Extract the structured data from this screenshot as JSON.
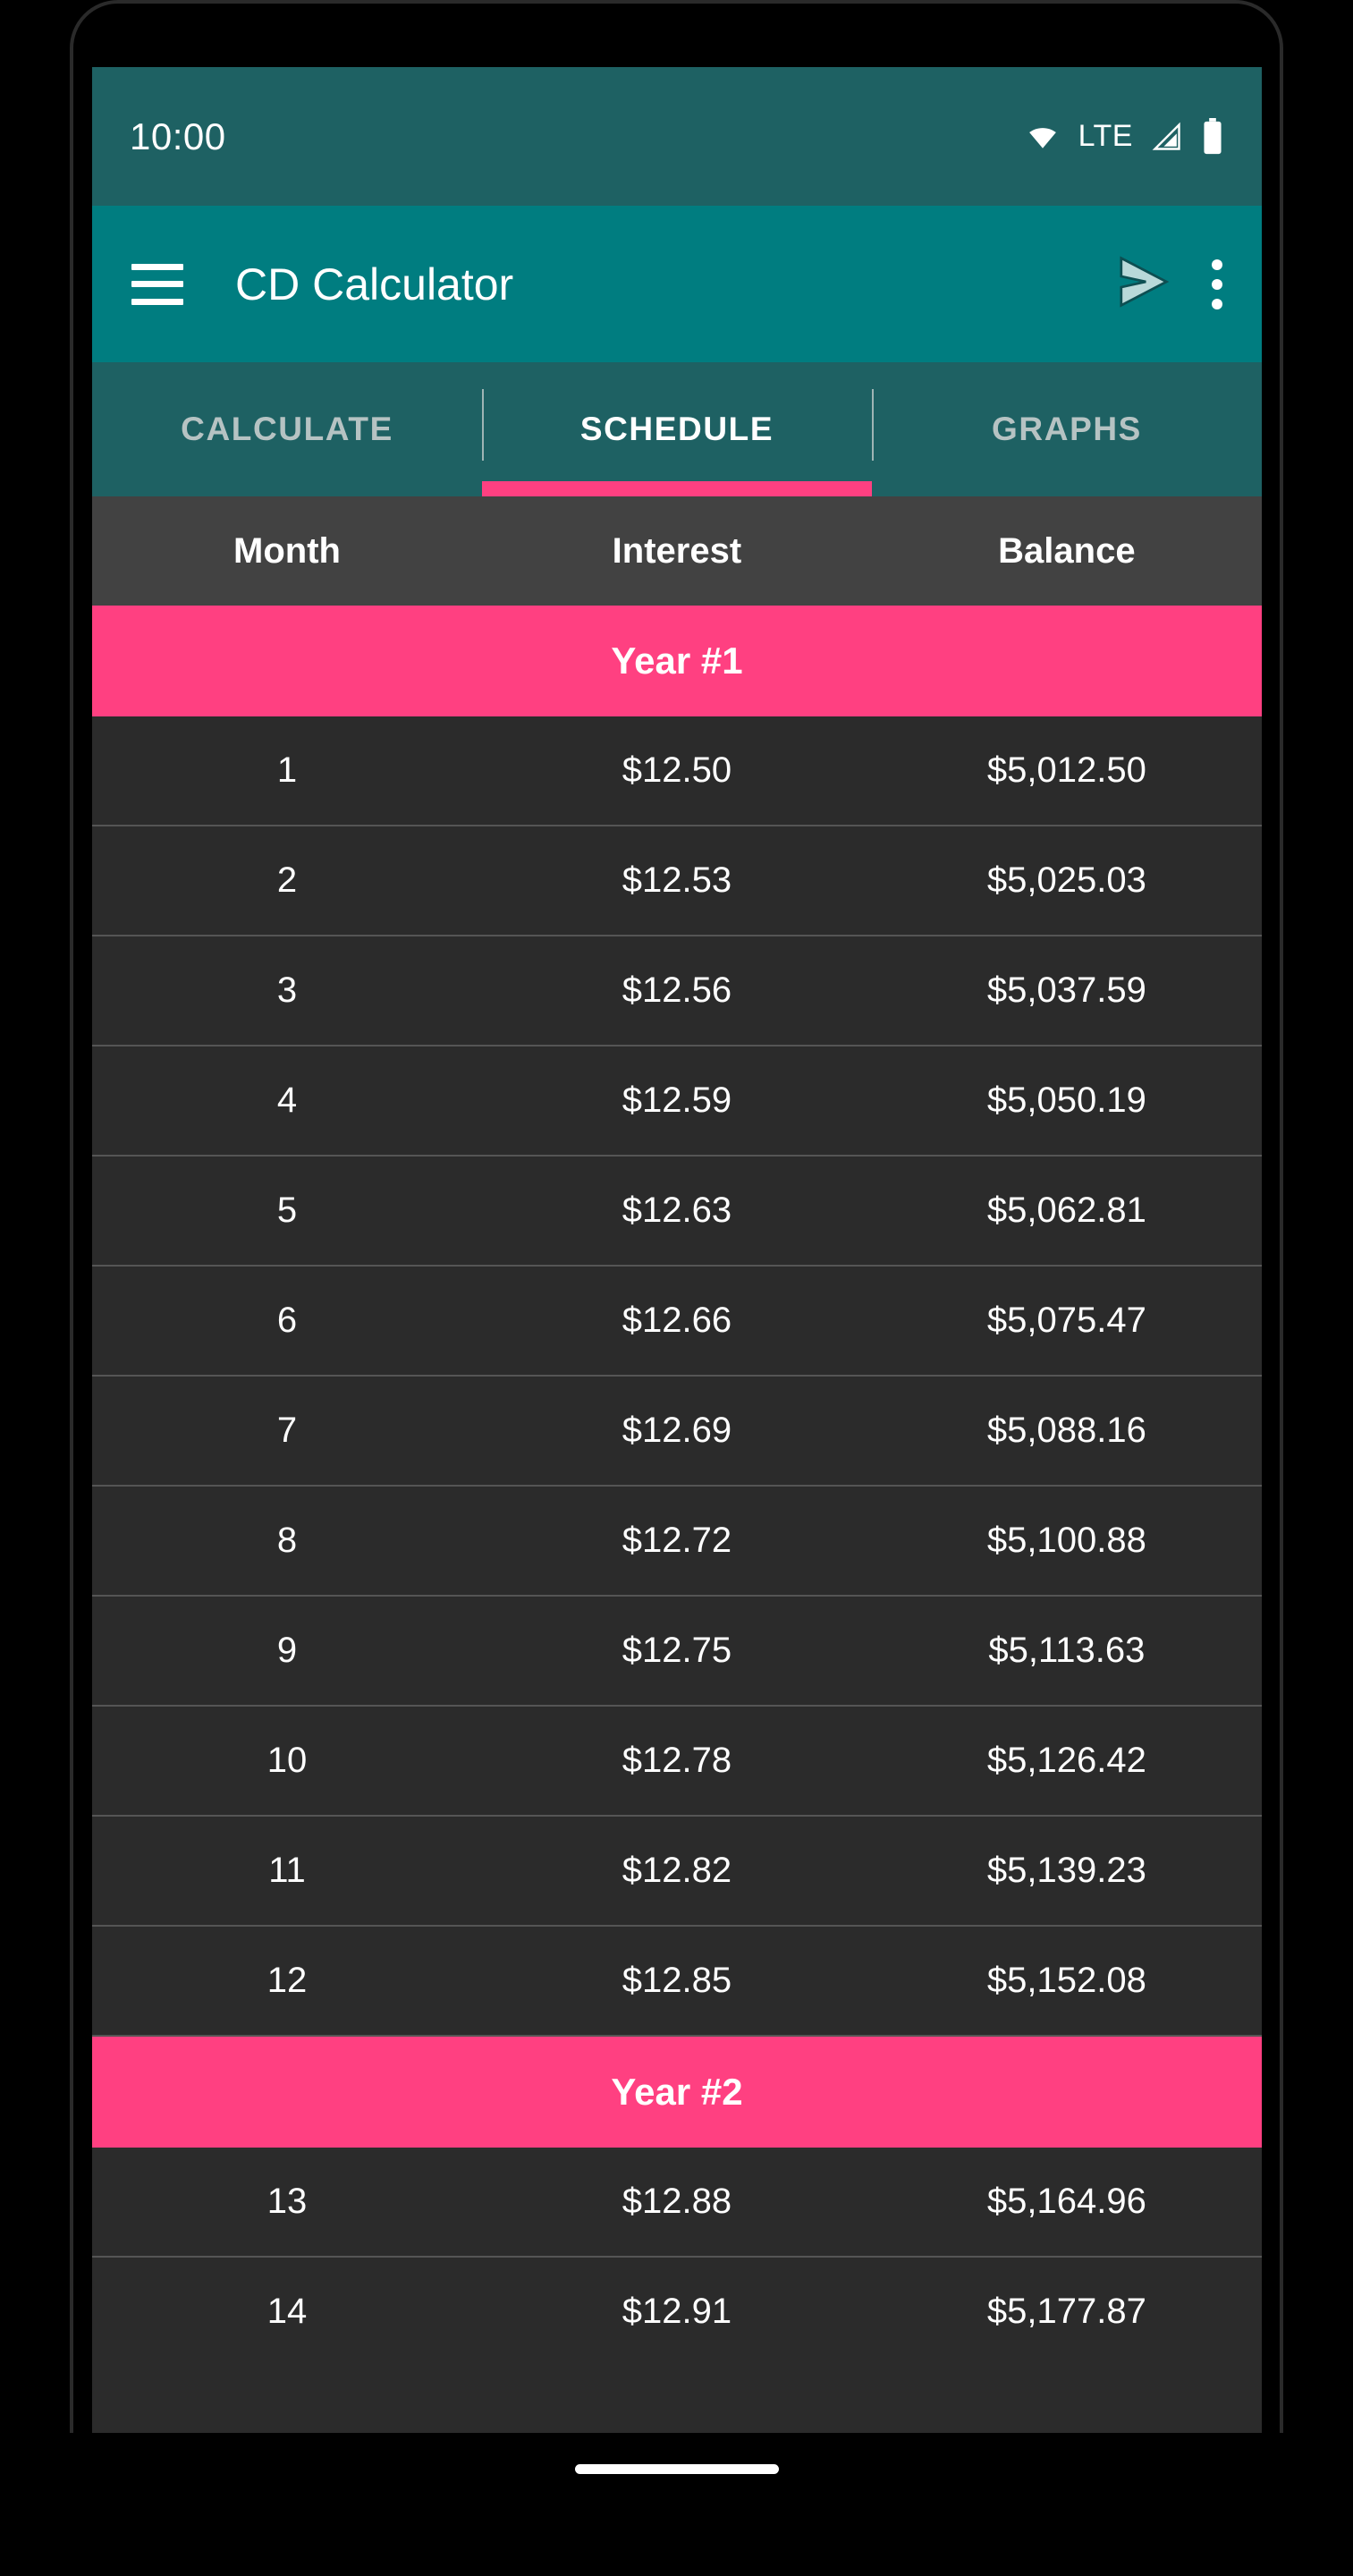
{
  "status_bar": {
    "time": "10:00",
    "network_label": "LTE",
    "icons": [
      "wifi-icon",
      "signal-icon",
      "battery-icon"
    ]
  },
  "app_bar": {
    "title": "CD Calculator",
    "menu_icon": "hamburger-menu-icon",
    "send_icon": "send-icon",
    "overflow_icon": "overflow-menu-icon"
  },
  "tabs": [
    {
      "label": "CALCULATE",
      "active": false
    },
    {
      "label": "SCHEDULE",
      "active": true
    },
    {
      "label": "GRAPHS",
      "active": false
    }
  ],
  "table": {
    "columns": [
      "Month",
      "Interest",
      "Balance"
    ],
    "rows": [
      {
        "type": "year",
        "label": "Year #1"
      },
      {
        "type": "data",
        "month": "1",
        "interest": "$12.50",
        "balance": "$5,012.50"
      },
      {
        "type": "data",
        "month": "2",
        "interest": "$12.53",
        "balance": "$5,025.03"
      },
      {
        "type": "data",
        "month": "3",
        "interest": "$12.56",
        "balance": "$5,037.59"
      },
      {
        "type": "data",
        "month": "4",
        "interest": "$12.59",
        "balance": "$5,050.19"
      },
      {
        "type": "data",
        "month": "5",
        "interest": "$12.63",
        "balance": "$5,062.81"
      },
      {
        "type": "data",
        "month": "6",
        "interest": "$12.66",
        "balance": "$5,075.47"
      },
      {
        "type": "data",
        "month": "7",
        "interest": "$12.69",
        "balance": "$5,088.16"
      },
      {
        "type": "data",
        "month": "8",
        "interest": "$12.72",
        "balance": "$5,100.88"
      },
      {
        "type": "data",
        "month": "9",
        "interest": "$12.75",
        "balance": "$5,113.63"
      },
      {
        "type": "data",
        "month": "10",
        "interest": "$12.78",
        "balance": "$5,126.42"
      },
      {
        "type": "data",
        "month": "11",
        "interest": "$12.82",
        "balance": "$5,139.23"
      },
      {
        "type": "data",
        "month": "12",
        "interest": "$12.85",
        "balance": "$5,152.08"
      },
      {
        "type": "year",
        "label": "Year #2"
      },
      {
        "type": "data",
        "month": "13",
        "interest": "$12.88",
        "balance": "$5,164.96"
      },
      {
        "type": "data",
        "month": "14",
        "interest": "$12.91",
        "balance": "$5,177.87"
      }
    ]
  },
  "colors": {
    "status_bar": "#1e6163",
    "app_bar": "#007d80",
    "tab_bar": "#1e6163",
    "accent_pink": "#ff4081",
    "table_header": "#424242",
    "table_row": "#2b2b2b",
    "divider": "#555555",
    "text_primary": "#ffffff",
    "text_inactive": "#b6c3c3"
  },
  "nav": {
    "gesture_pill": "home-gesture-pill"
  }
}
